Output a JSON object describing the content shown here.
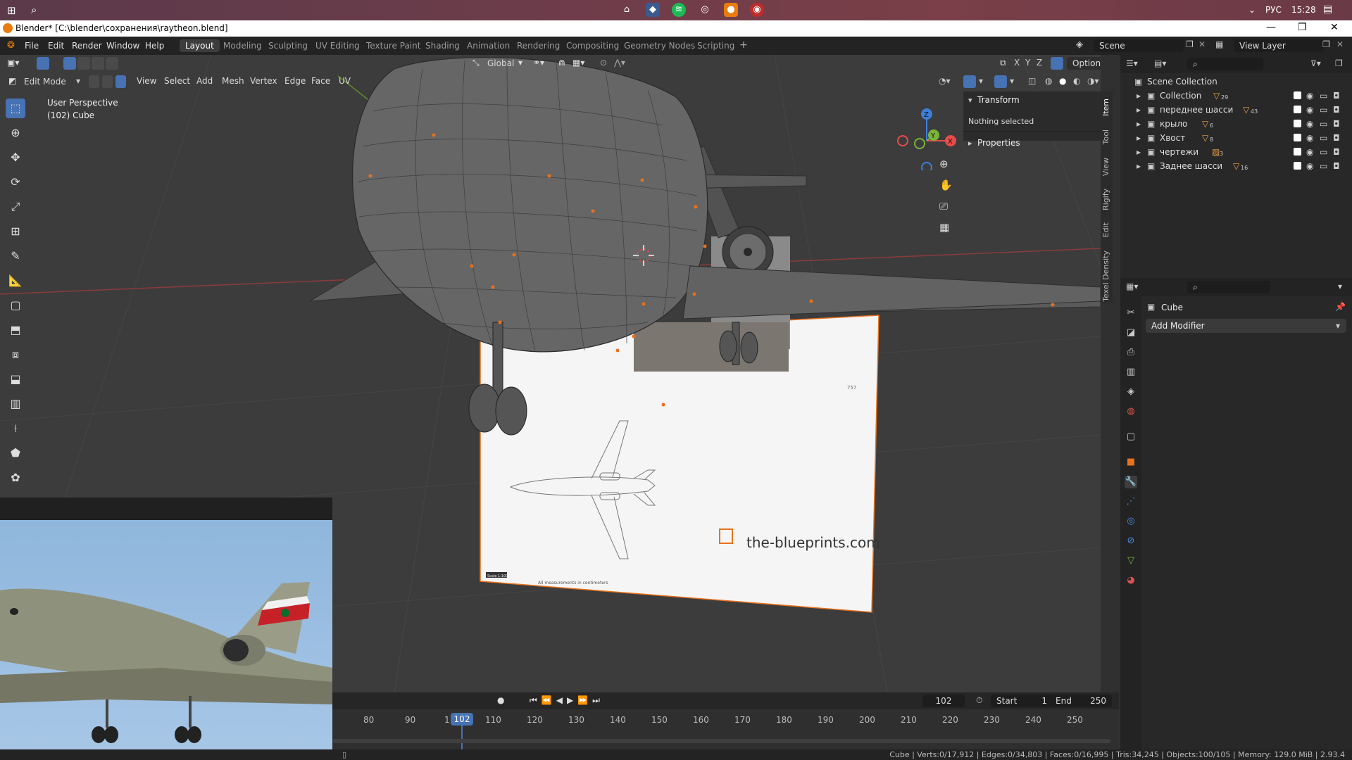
{
  "taskbar": {
    "lang": "РУС",
    "time": "15:28"
  },
  "window": {
    "title": "Blender* [C:\\blender\\сохранения\\raytheon.blend]"
  },
  "menus": [
    "File",
    "Edit",
    "Render",
    "Window",
    "Help"
  ],
  "workspaces": [
    "Layout",
    "Modeling",
    "Sculpting",
    "UV Editing",
    "Texture Paint",
    "Shading",
    "Animation",
    "Rendering",
    "Compositing",
    "Geometry Nodes",
    "Scripting"
  ],
  "active_workspace": "Layout",
  "scene": {
    "name": "Scene",
    "view_layer": "View Layer"
  },
  "viewport_header": {
    "transform_orientation": "Global",
    "options": "Options",
    "axes": [
      "X",
      "Y",
      "Z"
    ]
  },
  "viewport_header2": {
    "mode": "Edit Mode",
    "menus": [
      "View",
      "Select",
      "Add",
      "Mesh",
      "Vertex",
      "Edge",
      "Face",
      "UV"
    ]
  },
  "viewport": {
    "perspective_label": "User Perspective",
    "object_label": "(102) Cube",
    "blueprint_watermark": "the-blueprints.com",
    "blueprint_note": "All measurements in centimeters",
    "blueprint_scale": "Scale 1:100",
    "blueprint_dim": "757"
  },
  "npanel": {
    "transform_header": "Transform",
    "nothing_selected": "Nothing selected",
    "properties_header": "Properties",
    "tabs": [
      "Item",
      "Tool",
      "View",
      "Rigify",
      "Edit",
      "Texel Density"
    ]
  },
  "gizmo": {
    "x": "X",
    "y": "Y",
    "z": "Z"
  },
  "outliner": {
    "root": "Scene Collection",
    "items": [
      {
        "name": "Collection",
        "count": "29"
      },
      {
        "name": "переднее шасси",
        "count": "43"
      },
      {
        "name": "крыло",
        "count": "6"
      },
      {
        "name": "Хвост",
        "count": "8"
      },
      {
        "name": "чертежи",
        "count": "3"
      },
      {
        "name": "Заднее шасси",
        "count": "16"
      }
    ]
  },
  "properties": {
    "object_name": "Cube",
    "add_modifier": "Add Modifier"
  },
  "timeline": {
    "current_frame": "102",
    "start_label": "Start",
    "start": "1",
    "end_label": "End",
    "end": "250",
    "ticks": [
      "80",
      "90",
      "1",
      "110",
      "120",
      "130",
      "140",
      "150",
      "160",
      "170",
      "180",
      "190",
      "200",
      "210",
      "220",
      "230",
      "240",
      "250"
    ]
  },
  "status": {
    "text": "Cube | Verts:0/17,912 | Edges:0/34,803 | Faces:0/16,995 | Tris:34,245 | Objects:100/105 | Memory: 129.0 MiB | 2.93.4"
  },
  "colors": {
    "accent": "#4772b3",
    "selected_vertex": "#e8711c",
    "x_axis": "#e84b4b",
    "y_axis": "#7ab43a",
    "z_axis": "#3d7fd9"
  }
}
